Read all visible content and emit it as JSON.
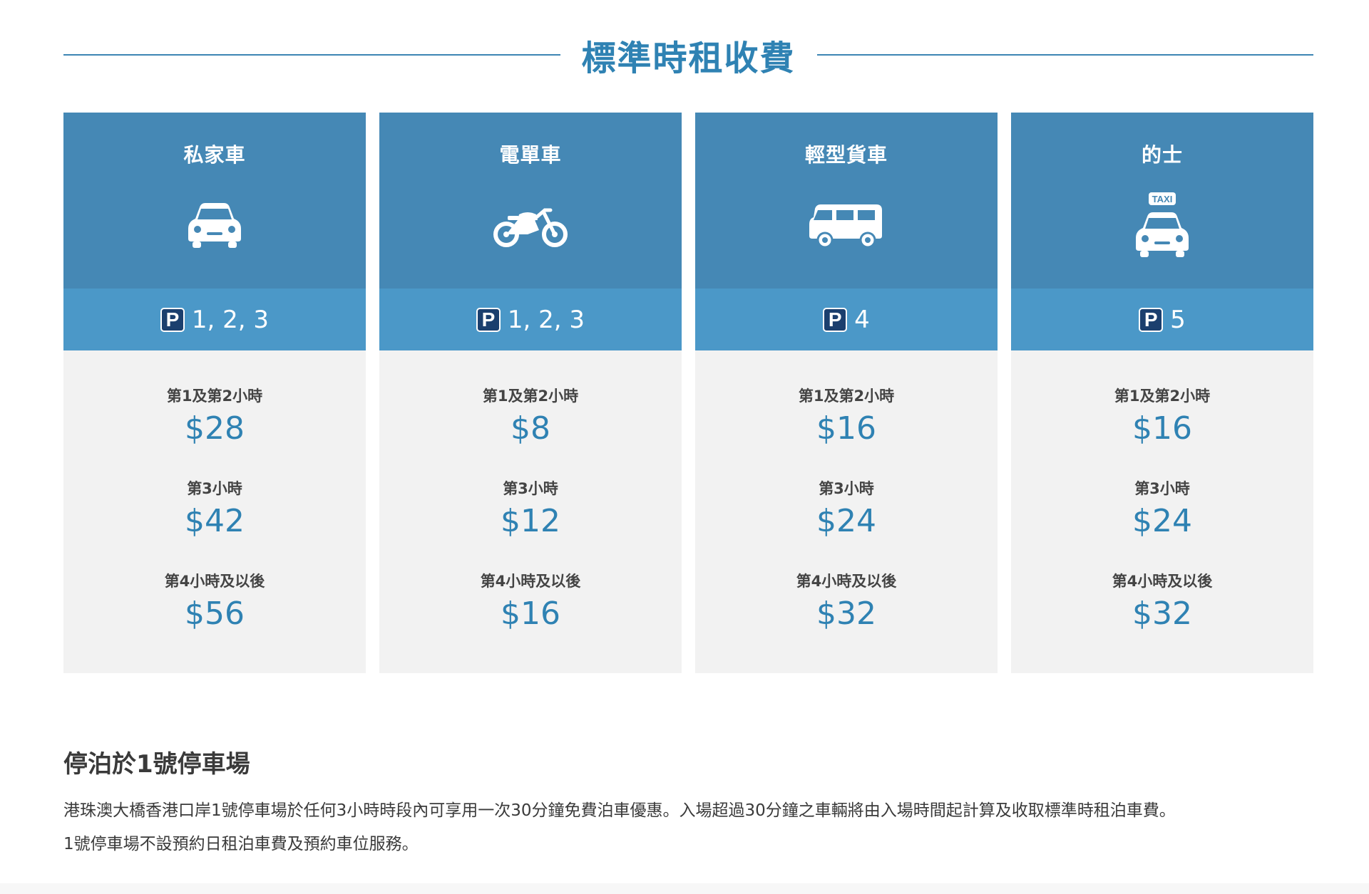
{
  "title": "標準時租收費",
  "cards": [
    {
      "name": "私家車",
      "icon": "car-icon",
      "zone_prefix": "P",
      "zone": "1, 2, 3",
      "rates": [
        {
          "label": "第1及第2小時",
          "price": "$28"
        },
        {
          "label": "第3小時",
          "price": "$42"
        },
        {
          "label": "第4小時及以後",
          "price": "$56"
        }
      ]
    },
    {
      "name": "電單車",
      "icon": "motorcycle-icon",
      "zone_prefix": "P",
      "zone": "1, 2, 3",
      "rates": [
        {
          "label": "第1及第2小時",
          "price": "$8"
        },
        {
          "label": "第3小時",
          "price": "$12"
        },
        {
          "label": "第4小時及以後",
          "price": "$16"
        }
      ]
    },
    {
      "name": "輕型貨車",
      "icon": "van-icon",
      "zone_prefix": "P",
      "zone": "4",
      "rates": [
        {
          "label": "第1及第2小時",
          "price": "$16"
        },
        {
          "label": "第3小時",
          "price": "$24"
        },
        {
          "label": "第4小時及以後",
          "price": "$32"
        }
      ]
    },
    {
      "name": "的士",
      "icon": "taxi-icon",
      "taxi_sign": "TAXI",
      "zone_prefix": "P",
      "zone": "5",
      "rates": [
        {
          "label": "第1及第2小時",
          "price": "$16"
        },
        {
          "label": "第3小時",
          "price": "$24"
        },
        {
          "label": "第4小時及以後",
          "price": "$32"
        }
      ]
    }
  ],
  "note": {
    "heading": "停泊於1號停車場",
    "line1": "港珠澳大橋香港口岸1號停車場於任何3小時時段內可享用一次30分鐘免費泊車優惠。入場超過30分鐘之車輛將由入場時間起計算及收取標準時租泊車費。",
    "line2": "1號停車場不設預約日租泊車費及預約車位服務。"
  },
  "colors": {
    "accent": "#2f82b3",
    "card_head": "#4588b5",
    "card_zone": "#4b98c8",
    "card_body": "#f2f2f2",
    "badge": "#1b3f6e"
  }
}
